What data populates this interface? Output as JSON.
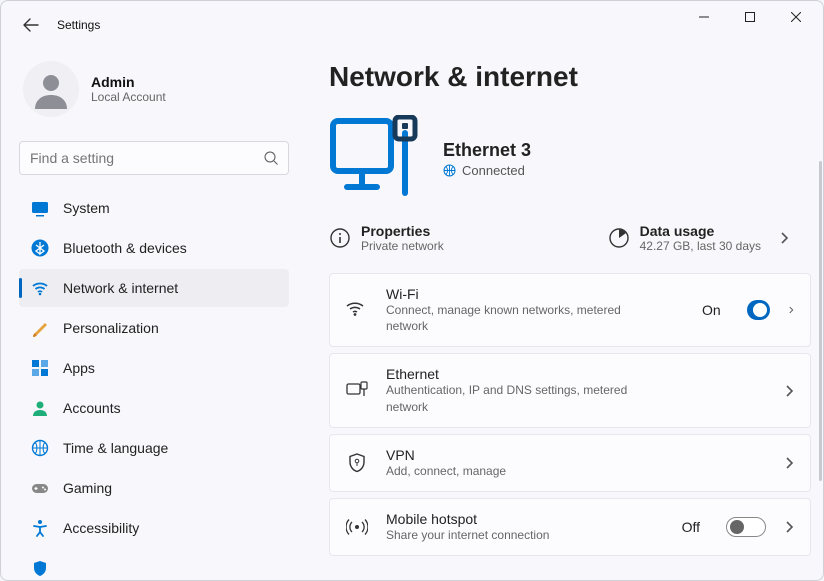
{
  "app": {
    "title": "Settings"
  },
  "user": {
    "name": "Admin",
    "type": "Local Account"
  },
  "search": {
    "placeholder": "Find a setting"
  },
  "nav": [
    {
      "label": "System",
      "icon": "system"
    },
    {
      "label": "Bluetooth & devices",
      "icon": "bluetooth"
    },
    {
      "label": "Network & internet",
      "icon": "wifi",
      "selected": true
    },
    {
      "label": "Personalization",
      "icon": "pen"
    },
    {
      "label": "Apps",
      "icon": "apps"
    },
    {
      "label": "Accounts",
      "icon": "person"
    },
    {
      "label": "Time & language",
      "icon": "globe"
    },
    {
      "label": "Gaming",
      "icon": "gamepad"
    },
    {
      "label": "Accessibility",
      "icon": "accessibility"
    },
    {
      "label": "",
      "icon": "privacy"
    }
  ],
  "page": {
    "heading": "Network & internet",
    "connection": {
      "name": "Ethernet 3",
      "status": "Connected"
    },
    "properties": {
      "title": "Properties",
      "sub": "Private network"
    },
    "usage": {
      "title": "Data usage",
      "sub": "42.27 GB, last 30 days"
    },
    "items": [
      {
        "title": "Wi-Fi",
        "sub": "Connect, manage known networks, metered network",
        "toggle": "On",
        "icon": "wifi"
      },
      {
        "title": "Ethernet",
        "sub": "Authentication, IP and DNS settings, metered network",
        "icon": "ethernet"
      },
      {
        "title": "VPN",
        "sub": "Add, connect, manage",
        "icon": "shield"
      },
      {
        "title": "Mobile hotspot",
        "sub": "Share your internet connection",
        "toggle": "Off",
        "icon": "hotspot"
      }
    ]
  }
}
